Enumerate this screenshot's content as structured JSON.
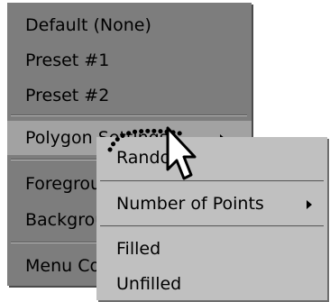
{
  "main_menu": {
    "items": [
      {
        "label": "Default (None)"
      },
      {
        "label": "Preset #1"
      },
      {
        "label": "Preset #2"
      },
      {
        "label": "Polygon Settings",
        "highlighted": true,
        "has_submenu": true
      },
      {
        "label": "Foreground"
      },
      {
        "label": "Background"
      },
      {
        "label": "Menu Color"
      }
    ]
  },
  "submenu": {
    "items": [
      {
        "label": "Random"
      },
      {
        "label": "Number of Points",
        "has_submenu": true
      },
      {
        "label": "Filled"
      },
      {
        "label": "Unfilled"
      }
    ]
  },
  "colors": {
    "main_menu_bg": "#7d7d7d",
    "highlight_bg": "#a2a2a2",
    "submenu_bg": "#c0c0c0",
    "text": "#000000"
  },
  "icons": {
    "cursor": "arrow-pointer-icon",
    "submenu_arrow": "triangle-right-icon"
  }
}
